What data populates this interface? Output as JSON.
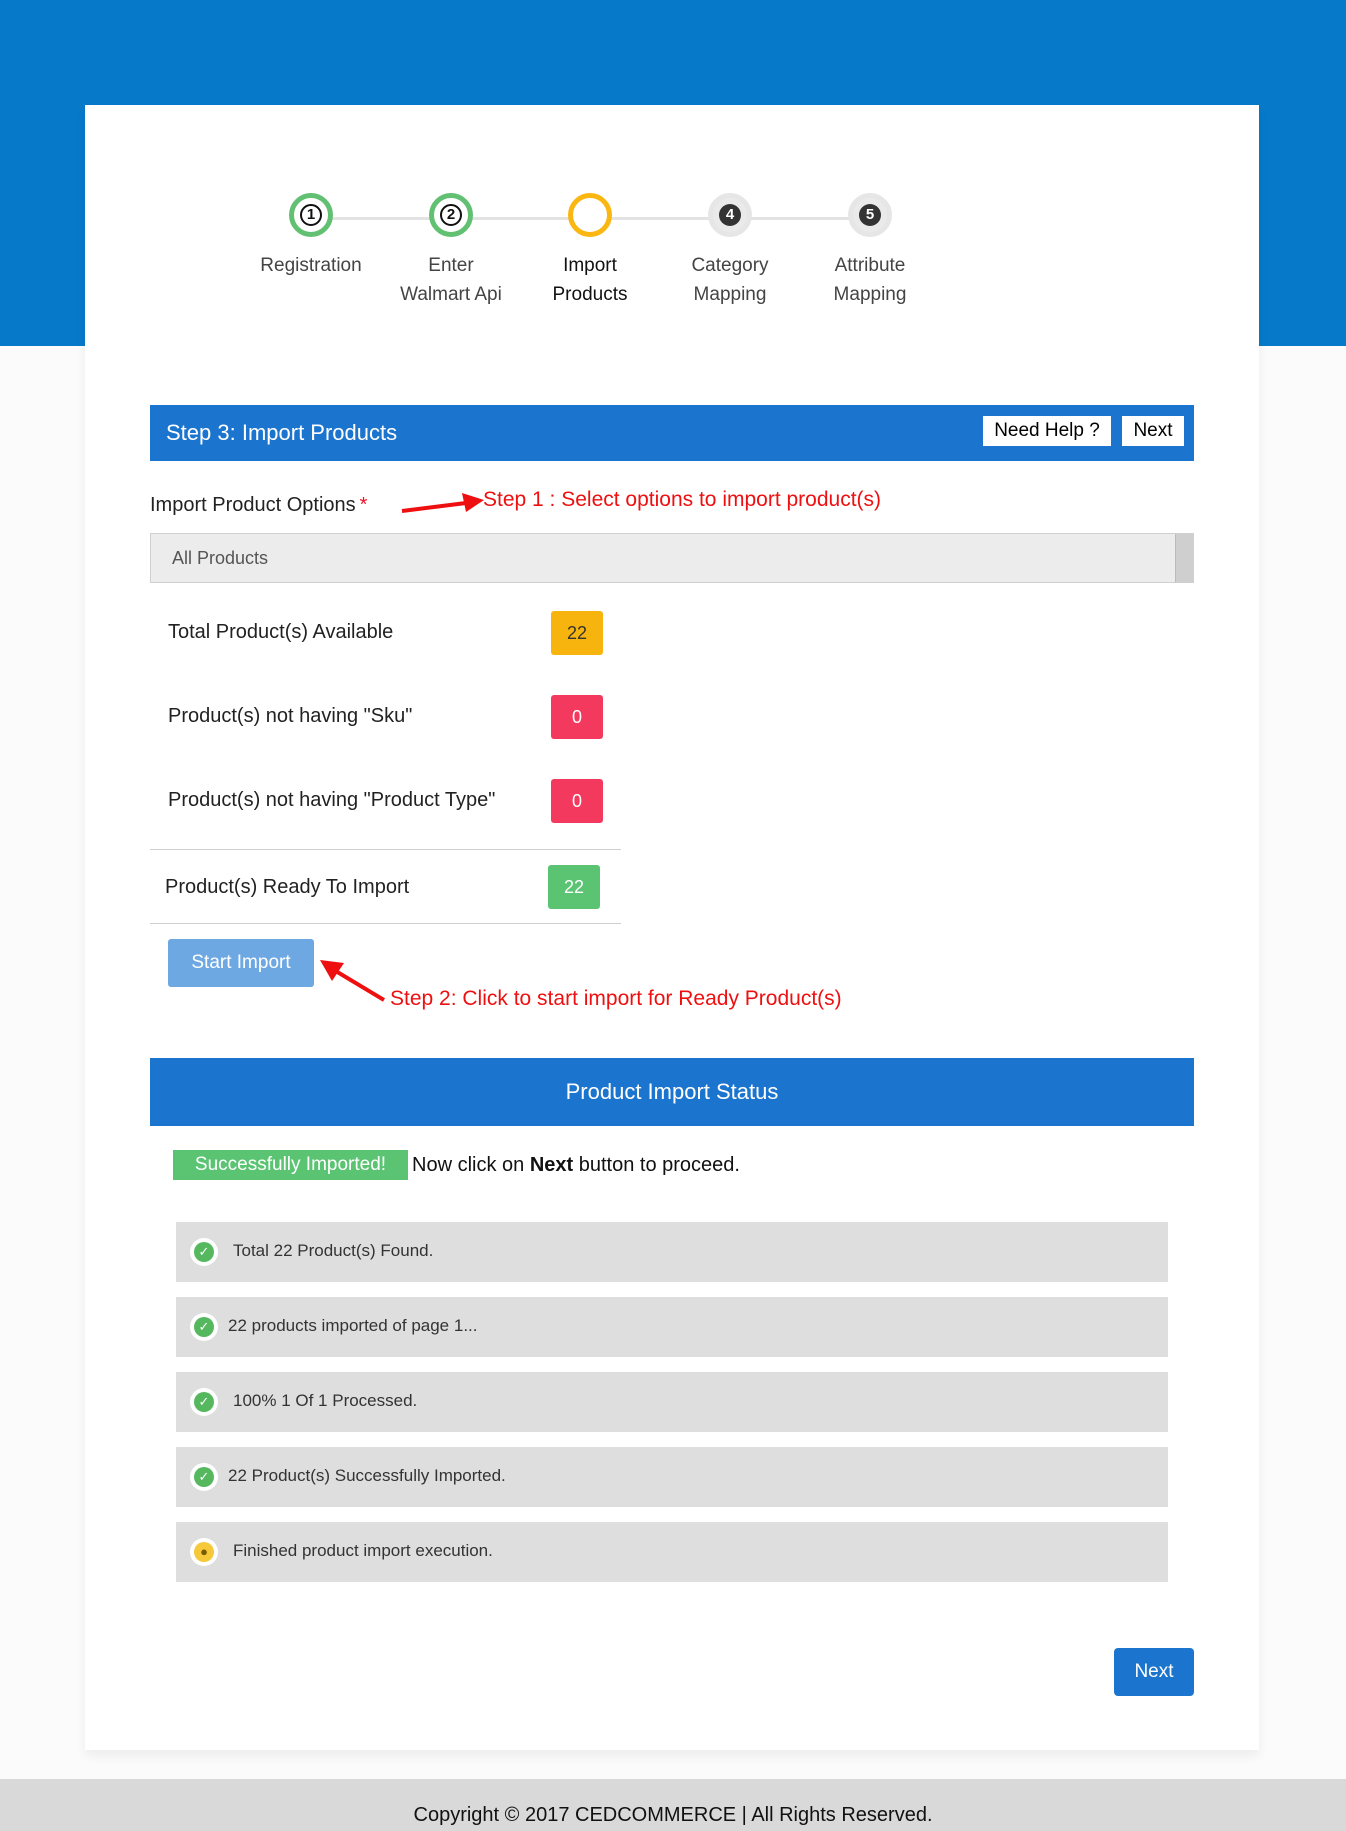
{
  "stepper": {
    "steps": [
      {
        "num": "1",
        "line1": "Registration",
        "line2": "",
        "state": "done"
      },
      {
        "num": "2",
        "line1": "Enter",
        "line2": "Walmart Api",
        "state": "done"
      },
      {
        "num": "",
        "line1": "Import",
        "line2": "Products",
        "state": "active"
      },
      {
        "num": "4",
        "line1": "Category",
        "line2": "Mapping",
        "state": "todo"
      },
      {
        "num": "5",
        "line1": "Attribute",
        "line2": "Mapping",
        "state": "todo"
      }
    ]
  },
  "header": {
    "title": "Step 3: Import Products",
    "help_label": "Need Help ?",
    "next_label": "Next"
  },
  "import_options": {
    "label": "Import Product Options",
    "required_mark": "*",
    "selected": "All Products"
  },
  "annotations": {
    "step1": "Step 1 : Select options to import product(s)",
    "step2": "Step 2: Click to start import for Ready Product(s)"
  },
  "stats": {
    "total_label": "Total Product(s) Available",
    "total_value": "22",
    "no_sku_label": "Product(s) not having \"Sku\"",
    "no_sku_value": "0",
    "no_type_label": "Product(s) not having \"Product Type\"",
    "no_type_value": "0",
    "ready_label": "Product(s) Ready To Import",
    "ready_value": "22"
  },
  "start_button": "Start Import",
  "status": {
    "title": "Product Import Status",
    "success_tag": "Successfully Imported!",
    "proceed_prefix": "Now click on",
    "proceed_bold": "Next",
    "proceed_suffix": "button to proceed.",
    "log": [
      "Total 22 Product(s) Found.",
      "22 products imported of page 1...",
      "100% 1 Of 1 Processed.",
      "22 Product(s) Successfully Imported.",
      "Finished product import execution."
    ]
  },
  "bottom_next": "Next",
  "footer": "Copyright © 2017 CEDCOMMERCE | All Rights Reserved.",
  "colors": {
    "brand_blue": "#1b74ce",
    "success_green": "#5bc472",
    "warning_yellow": "#f7b40f",
    "danger_red": "#f4395f",
    "annotation_red": "#ee1010"
  }
}
